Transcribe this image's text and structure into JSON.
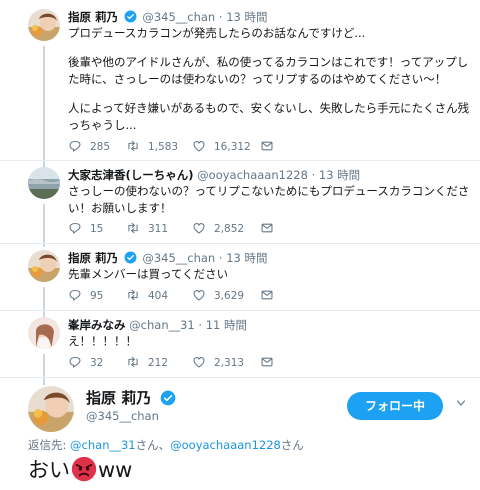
{
  "tweets": [
    {
      "name": "指原 莉乃",
      "handle": "@345__chan",
      "dot": "·",
      "time": "13 時間",
      "lines": [
        "プロデュースカラコンが発売したらのお話なんですけど...",
        "",
        "後輩や他のアイドルさんが、私の使ってるカラコンはこれです！ってアップし",
        "た時に、さっしーのは使わないの？ってリプするのはやめてください〜！",
        "",
        "人によって好き嫌いがあるもので、安くないし、失敗したら手元にたくさん残",
        "っちゃうし..."
      ],
      "replies": "285",
      "retweets": "1,583",
      "likes": "16,312"
    },
    {
      "name": "大家志津香(しーちゃん)",
      "handle": "@ooyachaaan1228",
      "dot": "·",
      "time": "13 時間",
      "lines": [
        "さっしーの使わないの？ってリプこないためにもプロデュースカラコンくださ",
        "い！お願いします！"
      ],
      "replies": "15",
      "retweets": "311",
      "likes": "2,852"
    },
    {
      "name": "指原 莉乃",
      "handle": "@345__chan",
      "dot": "·",
      "time": "13 時間",
      "lines": [
        "先輩メンバーは買ってください"
      ],
      "replies": "95",
      "retweets": "404",
      "likes": "3,629"
    },
    {
      "name": "峯岸みなみ",
      "handle": "@chan__31",
      "dot": "·",
      "time": "11 時間",
      "lines": [
        "え！！！！！"
      ],
      "replies": "32",
      "retweets": "212",
      "likes": "2,313"
    }
  ],
  "main": {
    "name": "指原 莉乃",
    "handle": "@345__chan",
    "follow_label": "フォロー中",
    "reply_prefix": "返信先: ",
    "reply_user1": "@chan__31",
    "reply_mid": "さん、",
    "reply_user2": "@ooyachaaan1228",
    "reply_suffix": "さん",
    "text_before": "おい",
    "text_after": "ww",
    "emoji": "angry-face-emoji"
  },
  "colors": {
    "accent": "#1da1f2",
    "link": "#1b95e0",
    "muted": "#657786",
    "line": "#ccd6dd",
    "emoji_red": "#e0314b"
  }
}
